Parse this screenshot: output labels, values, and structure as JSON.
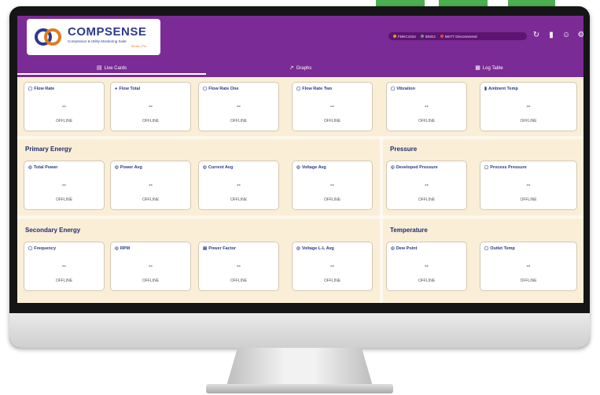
{
  "app": {
    "logo_title": "COMPSENSE",
    "logo_subtitle": "Compressor & Utility Monitoring Suite",
    "logo_by": "Sense_Pro"
  },
  "status": {
    "items": [
      {
        "label": "FMKC1024",
        "color": "#ff9800"
      },
      {
        "label": "IDEE2",
        "color": "#4caf50"
      },
      {
        "label": "MKTT Disconnected",
        "color": "#f44336"
      }
    ]
  },
  "header_icons": [
    {
      "name": "refresh-icon",
      "glyph": "↻"
    },
    {
      "name": "battery-icon",
      "glyph": "▮"
    },
    {
      "name": "user-icon",
      "glyph": "☺"
    },
    {
      "name": "settings-icon",
      "glyph": "⚙"
    }
  ],
  "tabs": [
    {
      "label": "Live Cards",
      "icon": "▤"
    },
    {
      "label": "Graphs",
      "icon": "↗"
    },
    {
      "label": "Log Table",
      "icon": "▦"
    }
  ],
  "colors": {
    "header": "#7b2b95",
    "body": "#fbeed7",
    "card_title": "#2a3a8a"
  },
  "top_cards": [
    {
      "title": "Flow Rate",
      "icon": "▢",
      "value": "--",
      "status": "OFFLINE"
    },
    {
      "title": "Flow Total",
      "icon": "●",
      "value": "--",
      "status": "OFFLINE"
    },
    {
      "title": "Flow Rate One",
      "icon": "▢",
      "value": "--",
      "status": "OFFLINE"
    },
    {
      "title": "Flow Rate Two",
      "icon": "▢",
      "value": "--",
      "status": "OFFLINE"
    },
    {
      "title": "Vibration",
      "icon": "▢",
      "value": "--",
      "status": "OFFLINE"
    },
    {
      "title": "Ambient Temp",
      "icon": "▮",
      "value": "--",
      "status": "OFFLINE"
    }
  ],
  "sections": {
    "primary_energy": {
      "title": "Primary Energy",
      "cards": [
        {
          "title": "Total Power",
          "icon": "◎",
          "value": "--",
          "status": "OFFLINE"
        },
        {
          "title": "Power Avg",
          "icon": "◎",
          "value": "--",
          "status": "OFFLINE"
        },
        {
          "title": "Current Avg",
          "icon": "◎",
          "value": "--",
          "status": "OFFLINE"
        },
        {
          "title": "Voltage Avg",
          "icon": "◎",
          "value": "--",
          "status": "OFFLINE"
        }
      ]
    },
    "pressure": {
      "title": "Pressure",
      "cards": [
        {
          "title": "Developed Pressure",
          "icon": "◎",
          "value": "--",
          "status": "OFFLINE"
        },
        {
          "title": "Process Pressure",
          "icon": "▢",
          "value": "--",
          "status": "OFFLINE"
        }
      ]
    },
    "secondary_energy": {
      "title": "Secondary Energy",
      "cards": [
        {
          "title": "Frequency",
          "icon": "▢",
          "value": "--",
          "status": "OFFLINE"
        },
        {
          "title": "RPM",
          "icon": "◎",
          "value": "--",
          "status": "OFFLINE"
        },
        {
          "title": "Power Factor",
          "icon": "▤",
          "value": "--",
          "status": "OFFLINE"
        },
        {
          "title": "Voltage L-L Avg",
          "icon": "◎",
          "value": "--",
          "status": "OFFLINE"
        }
      ]
    },
    "temperature": {
      "title": "Temperature",
      "cards": [
        {
          "title": "Dew Point",
          "icon": "◎",
          "value": "--",
          "status": "OFFLINE"
        },
        {
          "title": "Outlet Temp",
          "icon": "▢",
          "value": "--",
          "status": "OFFLINE"
        }
      ]
    }
  }
}
